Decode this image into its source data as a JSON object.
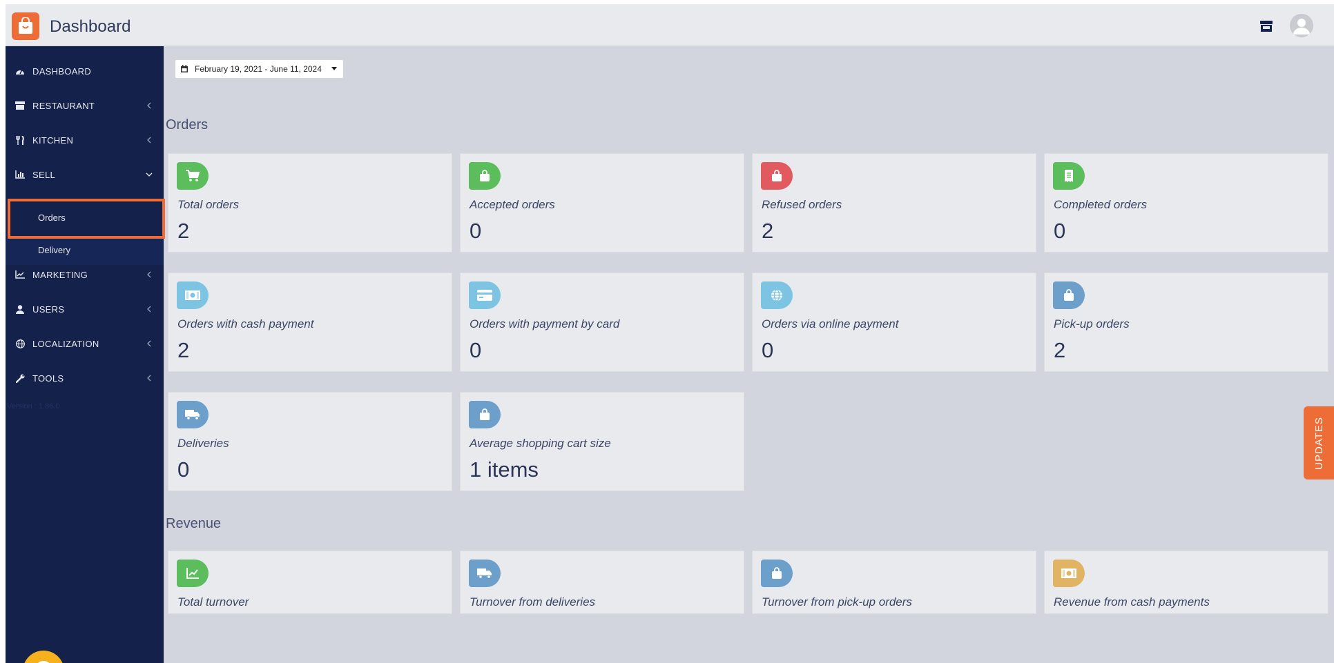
{
  "header": {
    "title": "Dashboard"
  },
  "sidebar": {
    "items": [
      {
        "label": "DASHBOARD",
        "icon": "dashboard-icon"
      },
      {
        "label": "RESTAURANT",
        "icon": "store-icon"
      },
      {
        "label": "KITCHEN",
        "icon": "utensils-icon"
      },
      {
        "label": "SELL",
        "icon": "bar-chart-icon"
      },
      {
        "label": "MARKETING",
        "icon": "line-chart-icon"
      },
      {
        "label": "USERS",
        "icon": "user-icon"
      },
      {
        "label": "LOCALIZATION",
        "icon": "globe-icon"
      },
      {
        "label": "TOOLS",
        "icon": "wrench-icon"
      }
    ],
    "sell_sub": [
      {
        "label": "Orders"
      },
      {
        "label": "Delivery"
      }
    ],
    "version": "Version : 1.86.0",
    "help": "?"
  },
  "filters": {
    "date_range": "February 19, 2021 - June 11, 2024"
  },
  "orders": {
    "title": "Orders",
    "cards": [
      {
        "label": "Total orders",
        "value": "2",
        "icon": "cart-icon",
        "color": "#5cbd5c"
      },
      {
        "label": "Accepted orders",
        "value": "0",
        "icon": "bag-icon",
        "color": "#5cbd5c"
      },
      {
        "label": "Refused orders",
        "value": "2",
        "icon": "bag-icon",
        "color": "#e05a5f"
      },
      {
        "label": "Completed orders",
        "value": "0",
        "icon": "receipt-icon",
        "color": "#5cbd5c"
      },
      {
        "label": "Orders with cash payment",
        "value": "2",
        "icon": "cash-icon",
        "color": "#7cc4e2"
      },
      {
        "label": "Orders with payment by card",
        "value": "0",
        "icon": "card-icon",
        "color": "#7cc4e2"
      },
      {
        "label": "Orders via online payment",
        "value": "0",
        "icon": "globe-icon",
        "color": "#7cc4e2"
      },
      {
        "label": "Pick-up orders",
        "value": "2",
        "icon": "bag-icon",
        "color": "#6d9fcb"
      },
      {
        "label": "Deliveries",
        "value": "0",
        "icon": "truck-icon",
        "color": "#6d9fcb"
      },
      {
        "label": "Average shopping cart size",
        "value": "1 items",
        "icon": "bag-icon",
        "color": "#6d9fcb"
      }
    ]
  },
  "revenue": {
    "title": "Revenue",
    "cards": [
      {
        "label": "Total turnover",
        "icon": "line-chart-icon",
        "color": "#5cbd5c"
      },
      {
        "label": "Turnover from deliveries",
        "icon": "truck-icon",
        "color": "#6d9fcb"
      },
      {
        "label": "Turnover from pick-up orders",
        "icon": "bag-icon",
        "color": "#6d9fcb"
      },
      {
        "label": "Revenue from cash payments",
        "icon": "cash-icon",
        "color": "#e0b462"
      }
    ]
  },
  "updates_tab": {
    "label": "UPDATES"
  },
  "colors": {
    "accent": "#ee6d36",
    "sidebar": "#14214a",
    "help": "#f5b21d"
  }
}
